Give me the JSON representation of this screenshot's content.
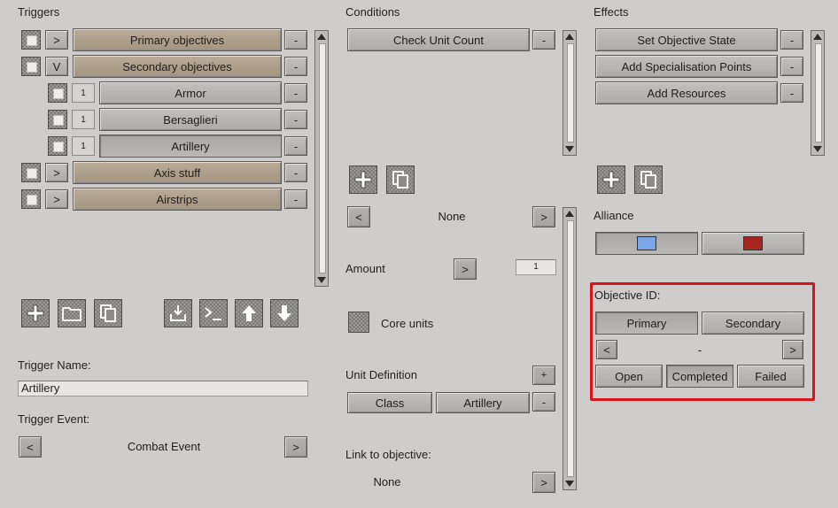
{
  "triggers": {
    "title": "Triggers",
    "rows": [
      {
        "expand": ">",
        "label": "Primary objectives",
        "remove": "-"
      },
      {
        "expand": "V",
        "label": "Secondary objectives",
        "remove": "-"
      },
      {
        "num": "1",
        "label": "Armor",
        "remove": "-"
      },
      {
        "num": "1",
        "label": "Bersaglieri",
        "remove": "-"
      },
      {
        "num": "1",
        "label": "Artillery",
        "remove": "-"
      },
      {
        "expand": ">",
        "label": "Axis stuff",
        "remove": "-"
      },
      {
        "expand": ">",
        "label": "Airstrips",
        "remove": "-"
      }
    ],
    "name_label": "Trigger Name:",
    "name_value": "Artillery",
    "event_label": "Trigger Event:",
    "event_value": "Combat Event",
    "prev": "<",
    "next": ">"
  },
  "conditions": {
    "title": "Conditions",
    "items": [
      {
        "label": "Check Unit Count",
        "remove": "-"
      }
    ],
    "selector_value": "None",
    "prev": "<",
    "next": ">",
    "amount_label": "Amount",
    "amount_value": "1",
    "amount_btn": ">",
    "core_units_label": "Core units",
    "unit_def_label": "Unit Definition",
    "unit_def_add": "+",
    "unit_def_class": "Class",
    "unit_def_value": "Artillery",
    "unit_def_remove": "-",
    "link_label": "Link to objective:",
    "link_value": "None",
    "link_btn": ">"
  },
  "effects": {
    "title": "Effects",
    "items": [
      {
        "label": "Set Objective State",
        "remove": "-"
      },
      {
        "label": "Add Specialisation Points",
        "remove": "-"
      },
      {
        "label": "Add Resources",
        "remove": "-"
      }
    ],
    "alliance_label": "Alliance",
    "alliance_colors": [
      "#7aa6e8",
      "#a8261f"
    ],
    "objective_id_label": "Objective ID:",
    "primary": "Primary",
    "secondary": "Secondary",
    "id_prev": "<",
    "id_value": "-",
    "id_next": ">",
    "open": "Open",
    "completed": "Completed",
    "failed": "Failed"
  }
}
